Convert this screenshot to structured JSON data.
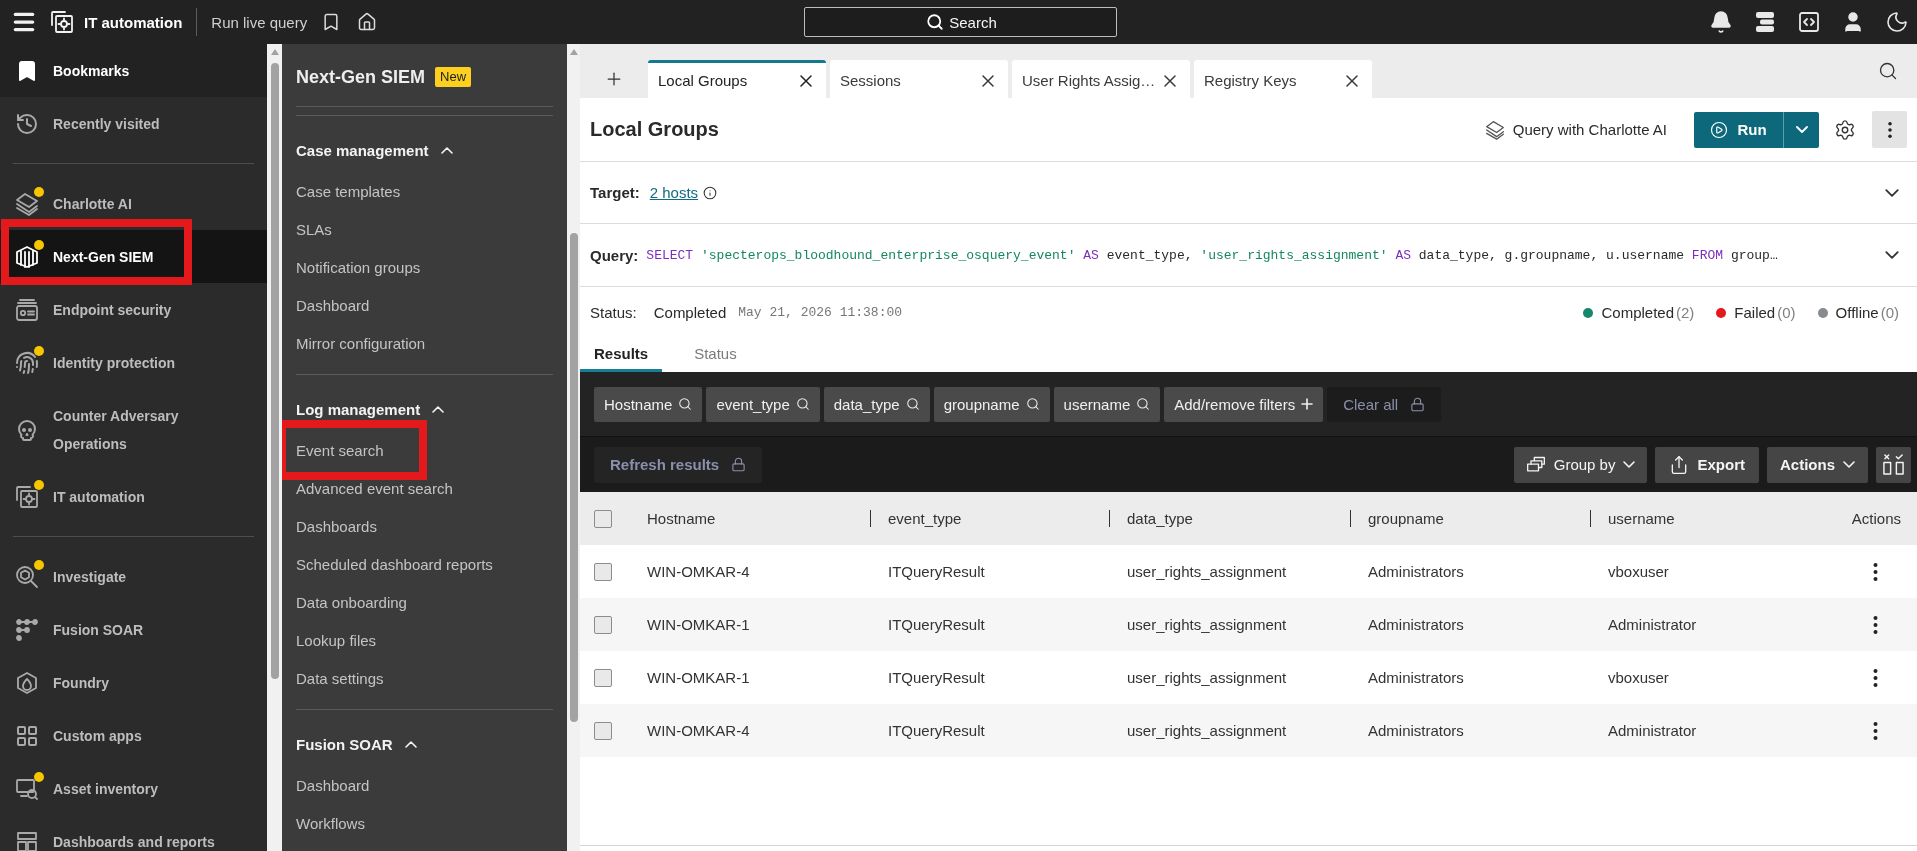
{
  "topbar": {
    "app_title": "IT automation",
    "page_title": "Run live query",
    "search": {
      "placeholder": "Search"
    }
  },
  "nav": {
    "sections": [
      {
        "items": [
          {
            "label": "Bookmarks",
            "kind": "pinned",
            "selected": false,
            "dot": false,
            "highlighted": false
          },
          {
            "label": "Recently visited",
            "kind": "link",
            "selected": false,
            "dot": false,
            "highlighted": false
          }
        ]
      },
      {
        "items": [
          {
            "label": "Charlotte AI",
            "kind": "link",
            "selected": false,
            "dot": true,
            "highlighted": false
          },
          {
            "label": "Next-Gen SIEM",
            "kind": "link",
            "selected": true,
            "dot": true,
            "highlighted": true
          },
          {
            "label": "Endpoint security",
            "kind": "link",
            "selected": false,
            "dot": false,
            "highlighted": false
          },
          {
            "label": "Identity protection",
            "kind": "link",
            "selected": false,
            "dot": true,
            "highlighted": false
          },
          {
            "label": "Counter Adversary Operations",
            "kind": "link",
            "selected": false,
            "dot": false,
            "highlighted": false
          },
          {
            "label": "IT automation",
            "kind": "link",
            "selected": false,
            "dot": true,
            "highlighted": false
          }
        ]
      },
      {
        "items": [
          {
            "label": "Investigate",
            "kind": "link",
            "selected": false,
            "dot": true,
            "highlighted": false
          },
          {
            "label": "Fusion SOAR",
            "kind": "link",
            "selected": false,
            "dot": false,
            "highlighted": false
          },
          {
            "label": "Foundry",
            "kind": "link",
            "selected": false,
            "dot": false,
            "highlighted": false
          },
          {
            "label": "Custom apps",
            "kind": "link",
            "selected": false,
            "dot": false,
            "highlighted": false
          },
          {
            "label": "Asset inventory",
            "kind": "link",
            "selected": false,
            "dot": true,
            "highlighted": false
          },
          {
            "label": "Dashboards and reports",
            "kind": "link",
            "selected": false,
            "dot": false,
            "highlighted": false
          }
        ]
      }
    ]
  },
  "subnav": {
    "title": "Next-Gen SIEM",
    "badge": "New",
    "sections": [
      {
        "title": "Case management",
        "expanded": true,
        "items": [
          {
            "label": "Case templates",
            "highlighted": false
          },
          {
            "label": "SLAs",
            "highlighted": false
          },
          {
            "label": "Notification groups",
            "highlighted": false
          },
          {
            "label": "Dashboard",
            "highlighted": false
          },
          {
            "label": "Mirror configuration",
            "highlighted": false
          }
        ]
      },
      {
        "title": "Log management",
        "expanded": true,
        "items": [
          {
            "label": "Event search",
            "highlighted": true
          },
          {
            "label": "Advanced event search",
            "highlighted": false
          },
          {
            "label": "Dashboards",
            "highlighted": false
          },
          {
            "label": "Scheduled dashboard reports",
            "highlighted": false
          },
          {
            "label": "Data onboarding",
            "highlighted": false
          },
          {
            "label": "Lookup files",
            "highlighted": false
          },
          {
            "label": "Data settings",
            "highlighted": false
          }
        ]
      },
      {
        "title": "Fusion SOAR",
        "expanded": true,
        "items": [
          {
            "label": "Dashboard",
            "highlighted": false
          },
          {
            "label": "Workflows",
            "highlighted": false
          }
        ]
      }
    ]
  },
  "tabs": [
    {
      "label": "Local Groups",
      "selected": true
    },
    {
      "label": "Sessions",
      "selected": false
    },
    {
      "label": "User Rights Assig…",
      "selected": false
    },
    {
      "label": "Registry Keys",
      "selected": false
    }
  ],
  "query_panel": {
    "title": "Local Groups",
    "charlotte_button": "Query with Charlotte AI",
    "run_button": "Run",
    "target": {
      "label": "Target:",
      "link": "2 hosts",
      "expanded": false
    },
    "query": {
      "label": "Query:",
      "expanded": false,
      "tokens": [
        {
          "kind": "keyword",
          "text": "SELECT"
        },
        {
          "kind": "string",
          "text": "'specterops_bloodhound_enterprise_osquery_event'"
        },
        {
          "kind": "keyword",
          "text": "AS"
        },
        {
          "kind": "plain",
          "text": "event_type,"
        },
        {
          "kind": "string",
          "text": "'user_rights_assignment'"
        },
        {
          "kind": "keyword",
          "text": "AS"
        },
        {
          "kind": "plain",
          "text": "data_type, g.groupname, u.username"
        },
        {
          "kind": "keyword",
          "text": "FROM"
        },
        {
          "kind": "plain",
          "text": "group…"
        }
      ]
    },
    "status": {
      "label": "Status:",
      "value": "Completed",
      "timestamp": "May 21, 2026 11:38:00",
      "legend": [
        {
          "label": "Completed",
          "count": "(2)",
          "color": "#16876a"
        },
        {
          "label": "Failed",
          "count": "(0)",
          "color": "#e3191b"
        },
        {
          "label": "Offline",
          "count": "(0)",
          "color": "#878a8f"
        }
      ]
    }
  },
  "result_tabs": [
    {
      "label": "Results",
      "selected": true
    },
    {
      "label": "Status",
      "selected": false
    }
  ],
  "filters": {
    "chips": [
      "Hostname",
      "event_type",
      "data_type",
      "groupname",
      "username"
    ],
    "add_button": "Add/remove filters",
    "clear_button": {
      "label": "Clear all",
      "disabled": true
    }
  },
  "toolbar": {
    "refresh_button": {
      "label": "Refresh results",
      "disabled": true
    },
    "group_by_button": "Group by",
    "export_button": "Export",
    "actions_button": "Actions"
  },
  "table": {
    "select_all_checked": false,
    "columns": [
      "Hostname",
      "event_type",
      "data_type",
      "groupname",
      "username",
      "Actions"
    ],
    "rows": [
      {
        "checked": false,
        "cells": [
          "WIN-OMKAR-4",
          "ITQueryResult",
          "user_rights_assignment",
          "Administrators",
          "vboxuser"
        ]
      },
      {
        "checked": false,
        "cells": [
          "WIN-OMKAR-1",
          "ITQueryResult",
          "user_rights_assignment",
          "Administrators",
          "Administrator"
        ]
      },
      {
        "checked": false,
        "cells": [
          "WIN-OMKAR-1",
          "ITQueryResult",
          "user_rights_assignment",
          "Administrators",
          "vboxuser"
        ]
      },
      {
        "checked": false,
        "cells": [
          "WIN-OMKAR-4",
          "ITQueryResult",
          "user_rights_assignment",
          "Administrators",
          "Administrator"
        ]
      }
    ]
  }
}
